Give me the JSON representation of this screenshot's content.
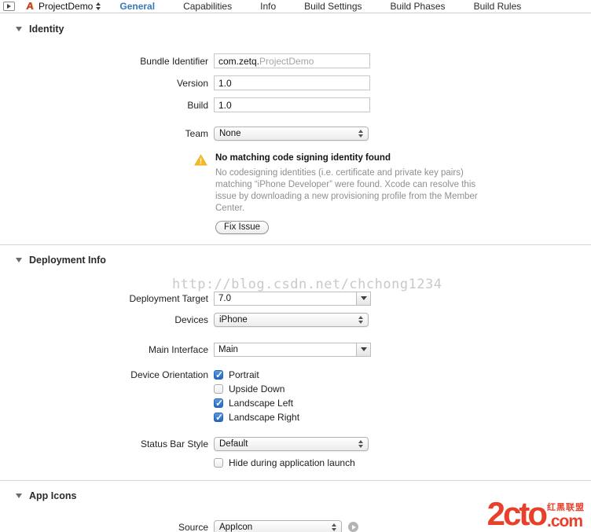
{
  "toolbar": {
    "project_name": "ProjectDemo",
    "tabs": [
      {
        "label": "General",
        "active": true
      },
      {
        "label": "Capabilities",
        "active": false
      },
      {
        "label": "Info",
        "active": false
      },
      {
        "label": "Build Settings",
        "active": false
      },
      {
        "label": "Build Phases",
        "active": false
      },
      {
        "label": "Build Rules",
        "active": false
      }
    ]
  },
  "identity": {
    "title": "Identity",
    "bundle_identifier": {
      "label": "Bundle Identifier",
      "value_prefix": "com.zetq.",
      "value_suffix": "ProjectDemo"
    },
    "version": {
      "label": "Version",
      "value": "1.0"
    },
    "build": {
      "label": "Build",
      "value": "1.0"
    },
    "team": {
      "label": "Team",
      "value": "None"
    },
    "warning": {
      "title": "No matching code signing identity found",
      "body": "No codesigning identities (i.e. certificate and private key pairs) matching “iPhone Developer” were found.  Xcode can resolve this issue by downloading a new provisioning profile from the Member Center.",
      "button_label": "Fix Issue"
    }
  },
  "deployment": {
    "title": "Deployment Info",
    "watermark": "http://blog.csdn.net/chchong1234",
    "deployment_target": {
      "label": "Deployment Target",
      "value": "7.0"
    },
    "devices": {
      "label": "Devices",
      "value": "iPhone"
    },
    "main_interface": {
      "label": "Main Interface",
      "value": "Main"
    },
    "device_orientation": {
      "label": "Device Orientation",
      "options": [
        {
          "label": "Portrait",
          "checked": true
        },
        {
          "label": "Upside Down",
          "checked": false
        },
        {
          "label": "Landscape Left",
          "checked": true
        },
        {
          "label": "Landscape Right",
          "checked": true
        }
      ]
    },
    "status_bar_style": {
      "label": "Status Bar Style",
      "value": "Default"
    },
    "hide_launch": {
      "label": "Hide during application launch",
      "checked": false
    }
  },
  "app_icons": {
    "title": "App Icons",
    "source": {
      "label": "Source",
      "value": "AppIcon"
    }
  },
  "logo": {
    "main": "2cto",
    "tagline": "红黑联盟",
    "com": ".com"
  },
  "colors": {
    "tab_active": "#3878b8",
    "warning_yellow": "#f7b921",
    "logo_red": "#e8402a"
  }
}
